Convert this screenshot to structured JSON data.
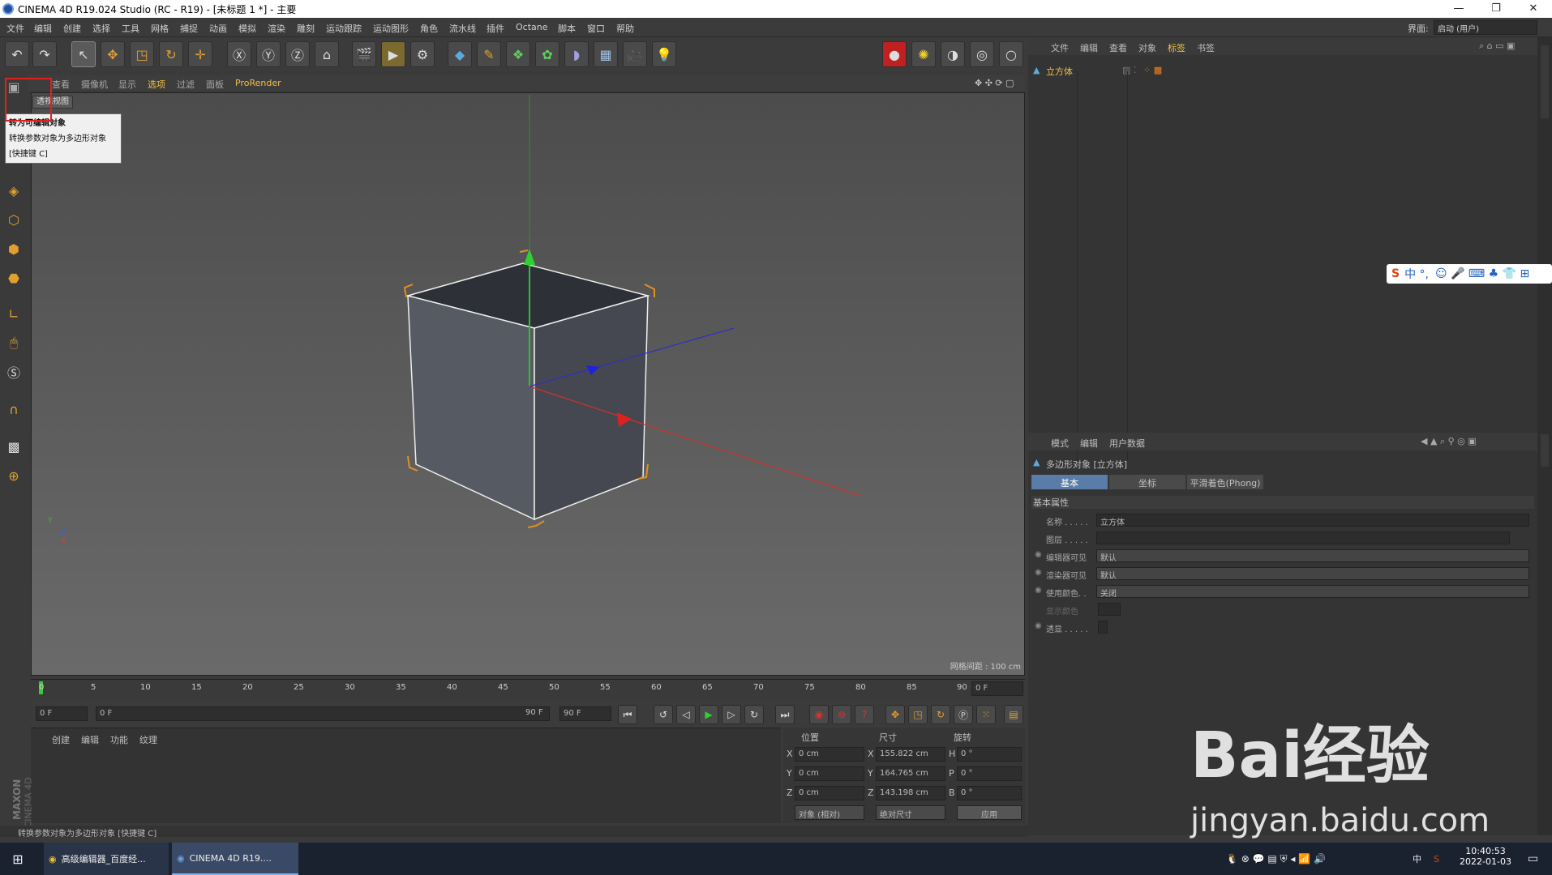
{
  "window": {
    "title": "CINEMA 4D R19.024 Studio (RC - R19) - [未标题 1 *] - 主要",
    "min": "—",
    "restore": "❐",
    "close": "✕"
  },
  "menu": [
    "文件",
    "编辑",
    "创建",
    "选择",
    "工具",
    "网格",
    "捕捉",
    "动画",
    "模拟",
    "渲染",
    "雕刻",
    "运动跟踪",
    "运动图形",
    "角色",
    "流水线",
    "插件",
    "Octane",
    "脚本",
    "窗口",
    "帮助"
  ],
  "layout": {
    "label": "界面:",
    "value": "启动 (用户)"
  },
  "viewport": {
    "menu": [
      "查看",
      "摄像机",
      "显示",
      "选项",
      "过滤",
      "面板",
      "ProRender"
    ],
    "tab": "透视视图",
    "grid_label": "网格间距 : 100 cm"
  },
  "tooltip": {
    "title": "转为可编辑对象",
    "desc": "转换参数对象为多边形对象",
    "shortcut": "[快捷键 C]"
  },
  "timeline": {
    "ticks": [
      "0",
      "5",
      "10",
      "15",
      "20",
      "25",
      "30",
      "35",
      "40",
      "45",
      "50",
      "55",
      "60",
      "65",
      "70",
      "75",
      "80",
      "85",
      "90"
    ],
    "end_field": "0 F"
  },
  "playbar": {
    "start": "0 F",
    "range_start": "0 F",
    "range_end": "90 F",
    "end": "90 F"
  },
  "material": {
    "menu": [
      "创建",
      "编辑",
      "功能",
      "纹理"
    ],
    "brand1": "MAXON",
    "brand2": "CINEMA 4D"
  },
  "coord": {
    "headers": [
      "位置",
      "尺寸",
      "旋转"
    ],
    "rows": [
      {
        "a": "X",
        "pos": "0 cm",
        "b": "X",
        "size": "155.822 cm",
        "c": "H",
        "rot": "0 °"
      },
      {
        "a": "Y",
        "pos": "0 cm",
        "b": "Y",
        "size": "164.765 cm",
        "c": "P",
        "rot": "0 °"
      },
      {
        "a": "Z",
        "pos": "0 cm",
        "b": "Z",
        "size": "143.198 cm",
        "c": "B",
        "rot": "0 °"
      }
    ],
    "mode": "对象 (相对)",
    "size_mode": "绝对尺寸",
    "apply": "应用"
  },
  "objects": {
    "menu": [
      "文件",
      "编辑",
      "查看",
      "对象",
      "标签",
      "书签"
    ],
    "item": "立方体"
  },
  "attributes": {
    "menu": [
      "模式",
      "编辑",
      "用户数据"
    ],
    "object_title": "多边形对象 [立方体]",
    "tabs": [
      "基本",
      "坐标",
      "平滑着色(Phong)"
    ],
    "section": "基本属性",
    "rows": [
      {
        "label": "名称 . . . . .",
        "value": "立方体"
      },
      {
        "label": "图层 . . . . .",
        "value": ""
      },
      {
        "label": "编辑器可见",
        "value": "默认"
      },
      {
        "label": "渲染器可见",
        "value": "默认"
      },
      {
        "label": "使用颜色. .",
        "value": "关闭"
      },
      {
        "label": "显示颜色",
        "value": ""
      },
      {
        "label": "透显 . . . . .",
        "value": ""
      }
    ]
  },
  "status": "转换参数对象为多边形对象 [快捷键 C]",
  "taskbar": {
    "apps": [
      {
        "label": "高级编辑器_百度经..."
      },
      {
        "label": "CINEMA 4D R19...."
      }
    ],
    "time": "10:40:53",
    "date": "2022-01-03",
    "lang": "中"
  },
  "ime": {
    "text": "中 °,"
  },
  "watermark": {
    "line1": "Bai经验",
    "line2": "jingyan.baidu.com"
  }
}
